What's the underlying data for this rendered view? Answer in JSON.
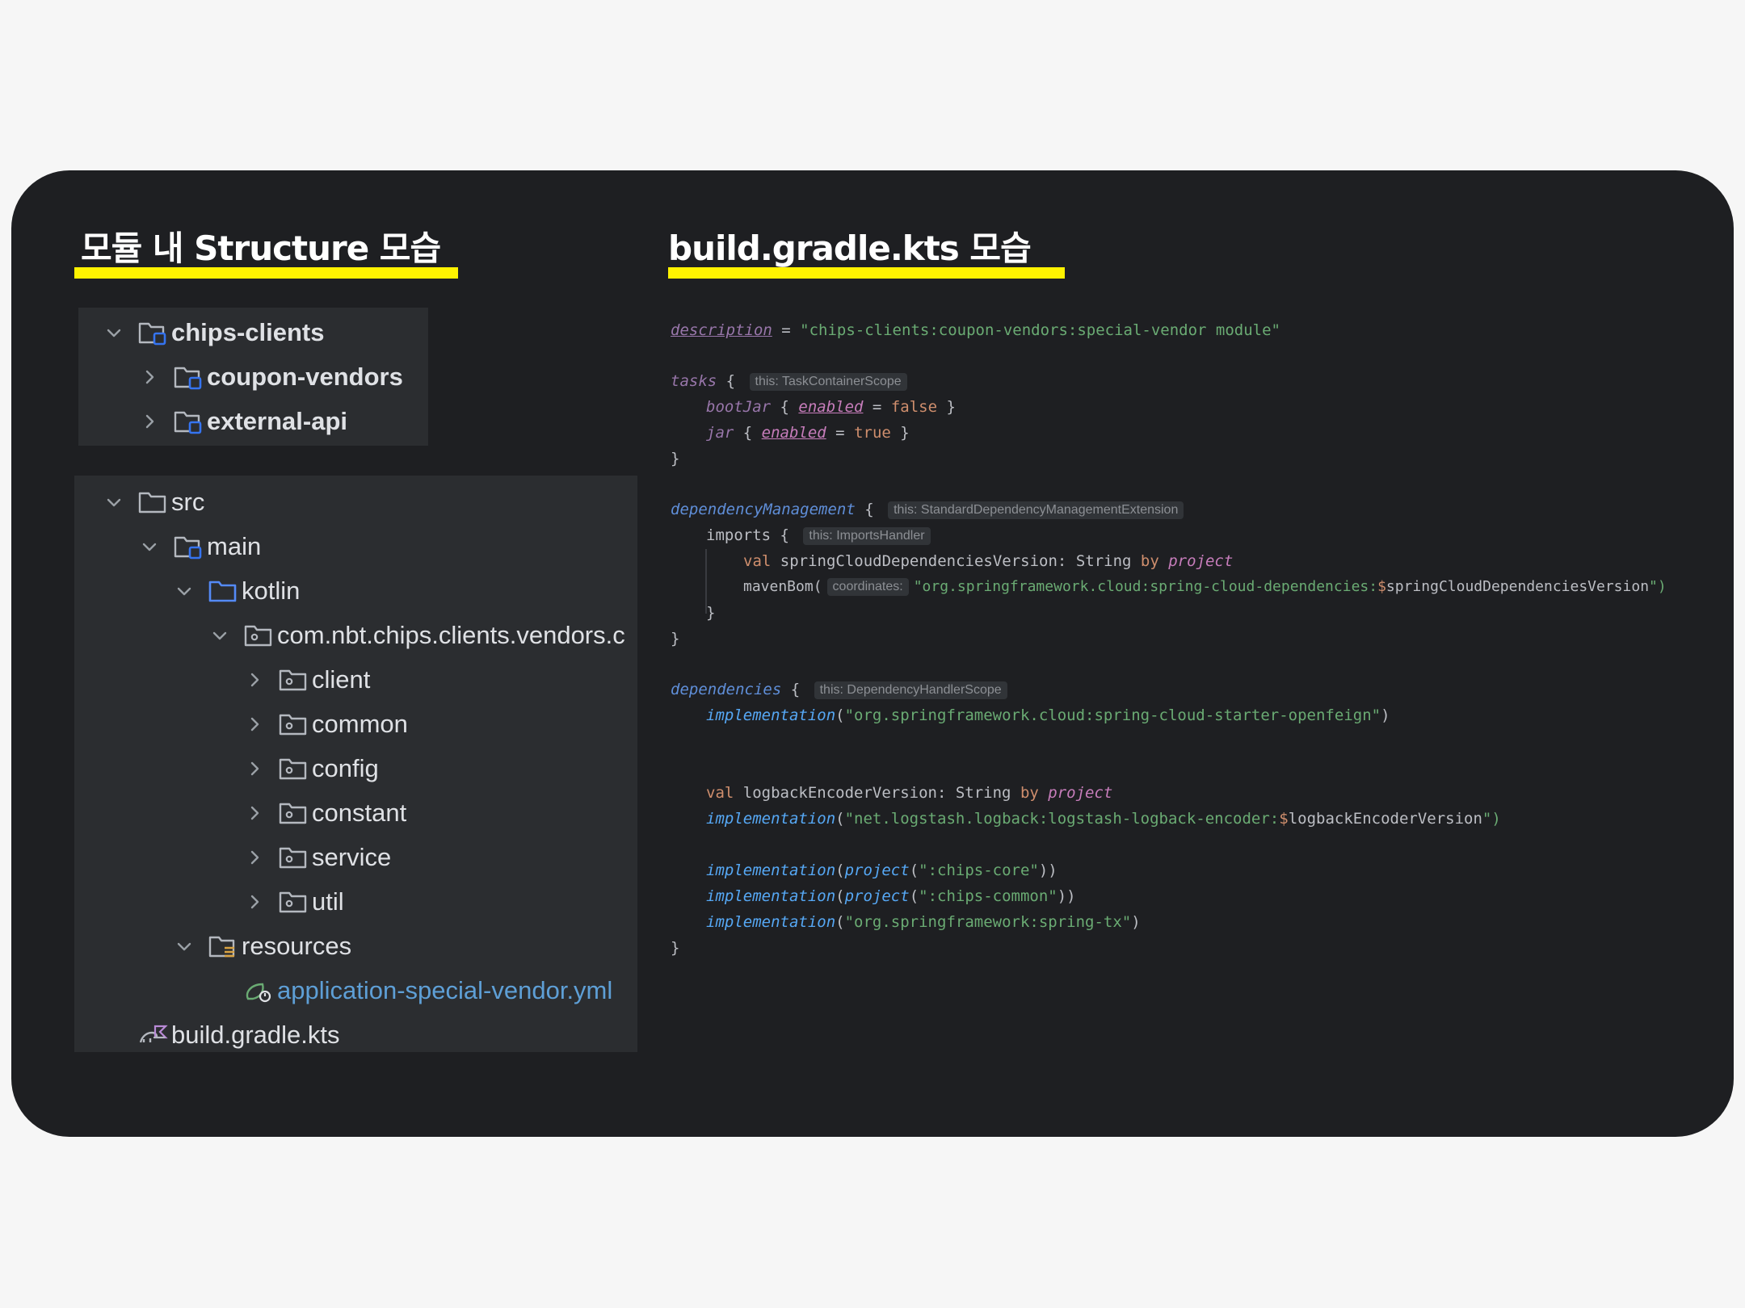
{
  "headings": {
    "structure": "모듈 내 Structure 모습",
    "gradle": "build.gradle.kts 모습"
  },
  "colors": {
    "background": "#f6f6f6",
    "card": "#1e1f22",
    "panel": "#2b2d30",
    "highlight": "#fff200",
    "module_icon_accent": "#3574f0",
    "folder_blue": "#548af7",
    "yml_green": "#6aab73"
  },
  "modules_tree": {
    "items": [
      {
        "label": "chips-clients",
        "icon": "module-folder-icon",
        "chevron": "expanded"
      },
      {
        "label": "coupon-vendors",
        "icon": "module-folder-icon",
        "chevron": "collapsed"
      },
      {
        "label": "external-api",
        "icon": "module-folder-icon",
        "chevron": "collapsed"
      }
    ]
  },
  "source_tree": {
    "items": [
      {
        "label": "src",
        "icon": "folder-icon",
        "chevron": "expanded"
      },
      {
        "label": "main",
        "icon": "source-root-folder-icon",
        "chevron": "expanded"
      },
      {
        "label": "kotlin",
        "icon": "source-folder-blue-icon",
        "chevron": "expanded"
      },
      {
        "label": "com.nbt.chips.clients.vendors.c",
        "icon": "package-icon",
        "chevron": "expanded"
      },
      {
        "label": "client",
        "icon": "package-icon",
        "chevron": "collapsed"
      },
      {
        "label": "common",
        "icon": "package-icon",
        "chevron": "collapsed"
      },
      {
        "label": "config",
        "icon": "package-icon",
        "chevron": "collapsed"
      },
      {
        "label": "constant",
        "icon": "package-icon",
        "chevron": "collapsed"
      },
      {
        "label": "service",
        "icon": "package-icon",
        "chevron": "collapsed"
      },
      {
        "label": "util",
        "icon": "package-icon",
        "chevron": "collapsed"
      },
      {
        "label": "resources",
        "icon": "resources-folder-icon",
        "chevron": "expanded"
      },
      {
        "label": "application-special-vendor.yml",
        "icon": "spring-yml-icon",
        "chevron": "none"
      },
      {
        "label": "build.gradle.kts",
        "icon": "gradle-kotlin-icon",
        "chevron": "none"
      }
    ]
  },
  "code": {
    "l1": {
      "a": "description",
      "b": " = ",
      "c": "\"chips-clients:coupon-vendors:special-vendor module\""
    },
    "l2": {
      "a": "tasks",
      "b": " { ",
      "hint": "this: TaskContainerScope"
    },
    "l3": {
      "a": "bootJar",
      "b": " { ",
      "c": "enabled",
      "d": " = ",
      "e": "false",
      "f": " }"
    },
    "l4": {
      "a": "jar",
      "b": " { ",
      "c": "enabled",
      "d": " = ",
      "e": "true",
      "f": " }"
    },
    "l5": {
      "a": "}"
    },
    "l6": {
      "a": "dependencyManagement",
      "b": " { ",
      "hint": "this: StandardDependencyManagementExtension"
    },
    "l7": {
      "a": "imports",
      "b": " { ",
      "hint": "this: ImportsHandler"
    },
    "l8": {
      "a": "val",
      "b": " springCloudDependenciesVersion: String ",
      "c": "by",
      "d": " ",
      "e": "project"
    },
    "l9": {
      "a": "mavenBom(",
      "hint": "coordinates:",
      "c": "\"org.springframework.cloud:spring-cloud-dependencies:",
      "d": "$",
      "e": "springCloudDependenciesVersion",
      "f": "\")"
    },
    "l10": {
      "a": "}"
    },
    "l11": {
      "a": "}"
    },
    "l12": {
      "a": "dependencies",
      "b": " { ",
      "hint": "this: DependencyHandlerScope"
    },
    "l13": {
      "a": "implementation",
      "b": "(",
      "c": "\"org.springframework.cloud:spring-cloud-starter-openfeign\"",
      "d": ")"
    },
    "l14": {
      "a": "val",
      "b": " logbackEncoderVersion: String ",
      "c": "by",
      "d": " ",
      "e": "project"
    },
    "l15": {
      "a": "implementation",
      "b": "(",
      "c": "\"net.logstash.logback:logstash-logback-encoder:",
      "d": "$",
      "e": "logbackEncoderVersion",
      "f": "\")"
    },
    "l16": {
      "a": "implementation",
      "b": "(",
      "c": "project",
      "d": "(",
      "e": "\":chips-core\"",
      "f": "))"
    },
    "l17": {
      "a": "implementation",
      "b": "(",
      "c": "project",
      "d": "(",
      "e": "\":chips-common\"",
      "f": "))"
    },
    "l18": {
      "a": "implementation",
      "b": "(",
      "c": "\"org.springframework:spring-tx\"",
      "d": ")"
    },
    "l19": {
      "a": "}"
    }
  }
}
